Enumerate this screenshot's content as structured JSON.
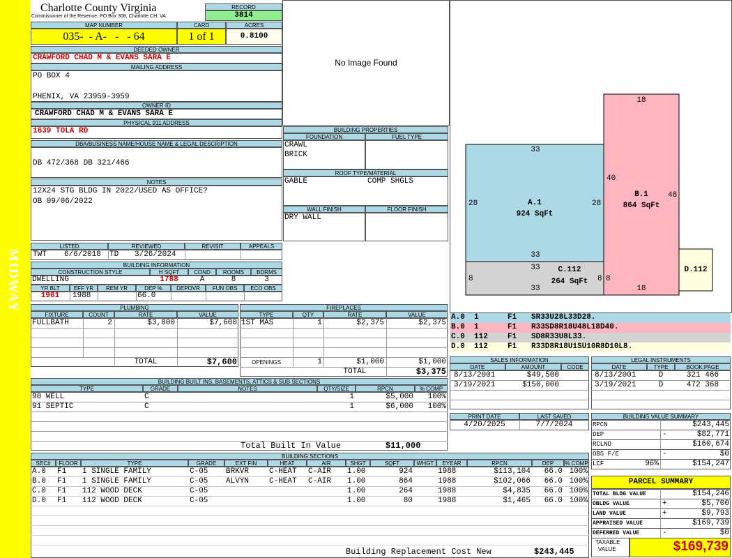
{
  "sidebar": {
    "label": "MIDWAY",
    "color": "#ffff00"
  },
  "header": {
    "county": "Charlotte County Virginia",
    "address": "Commissioner of the Revenue, PO Box 308, Charlotte CH, VA",
    "record_label": "RECORD",
    "record_value": "3814",
    "map_number_label": "MAP NUMBER",
    "map_number": "035-  - A-   -   - 64",
    "card_label": "CARD",
    "card": "1 of 1",
    "acres_label": "ACRES",
    "acres": "0.8100"
  },
  "owner": {
    "deeded_label": "DEEDED OWNER",
    "deeded": "CRAWFORD CHAD M & EVANS SARA E",
    "mailing_label": "MAILING ADDRESS",
    "mailing_line1": "PO BOX 4",
    "mailing_line2": "PHENIX, VA 23959-3959",
    "owner_id_label": "OWNER ID",
    "owner_id": "CRAWFORD CHAD M & EVANS SARA E",
    "physical_label": "PHYSICAL 911 ADDRESS",
    "physical": "1639 TOLA RD",
    "dba_label": "DBA/BUSINESS NAME/HOUSE NAME & LEGAL DESCRIPTION",
    "dba": "DB 472/368 DB 321/466",
    "notes_label": "NOTES",
    "notes_line1": "12X24 STG BLDG IN 2022/USED AS OFFICE?",
    "notes_line2": "OB 09/06/2022"
  },
  "photo": {
    "text": "No Image Found"
  },
  "building_props": {
    "title": "BUILDING PROPERTIES",
    "foundation_label": "FOUNDATION",
    "foundation_1": "CRAWL",
    "foundation_2": "BRICK",
    "fuel_label": "FUEL TYPE",
    "roof_label": "ROOF TYPE/MATERIAL",
    "roof_type": "GABLE",
    "roof_material": "COMP SHGLS",
    "wall_label": "WALL FINISH",
    "wall": "DRY WALL",
    "floor_label": "FLOOR FINISH"
  },
  "review": {
    "listed_label": "LISTED",
    "listed_by": "TWT",
    "listed_date": "6/6/2018",
    "reviewed_label": "REVIEWED",
    "reviewed_by": "TD",
    "reviewed_date": "3/26/2024",
    "revisit_label": "REVISIT",
    "appeals_label": "APPEALS"
  },
  "building_info": {
    "title": "BUILDING INFORMATION",
    "style_label": "CONSTRUCTION STYLE",
    "style": "DWELLING",
    "hsqft_label": "H SQFT",
    "hsqft": "1788",
    "cond_label": "COND",
    "cond": "A",
    "rooms_label": "ROOMS",
    "rooms": "8",
    "bdrms_label": "BDRMS",
    "bdrms": "3",
    "yrblt_label": "YR BLT",
    "yrblt": "1961",
    "effyr_label": "EFF YR",
    "effyr": "1988",
    "remyr_label": "REM YR",
    "remyr": "",
    "dep_label": "DEP %",
    "dep": "66.0",
    "depovr_label": "DEPOVR",
    "funobs_label": "FUN OBS",
    "ecoobs_label": "ECO OBS"
  },
  "plumbing": {
    "title": "PLUMBING",
    "headers": [
      "FIXTURE",
      "COUNT",
      "RATE",
      "VALUE"
    ],
    "rows": [
      {
        "fixture": "FULLBATH",
        "count": "2",
        "rate": "$3,800",
        "value": "$7,600"
      }
    ],
    "total_label": "TOTAL",
    "total": "$7,600"
  },
  "fireplaces": {
    "title": "FIREPLACES",
    "headers": [
      "TYPE",
      "QTY",
      "RATE",
      "VALUE"
    ],
    "rows": [
      {
        "type": "1ST MAS",
        "qty": "1",
        "rate": "$2,375",
        "value": "$2,375"
      }
    ],
    "openings_label": "OPENINGS",
    "openings_qty": "1",
    "openings_rate": "$1,000",
    "openings_value": "$1,000",
    "total_label": "TOTAL",
    "total": "$3,375"
  },
  "builtins": {
    "title": "BUILDING BUILT INS, BASEMENTS, ATTICS & SUB SECTIONS",
    "headers": [
      "TYPE",
      "GRADE",
      "NOTES",
      "QTY/SIZE",
      "RPCN",
      "% COMP"
    ],
    "rows": [
      {
        "type": "90 WELL",
        "grade": "C",
        "notes": "",
        "qty": "1",
        "rpcn": "$5,000",
        "comp": "100%"
      },
      {
        "type": "91 SEPTIC",
        "grade": "C",
        "notes": "",
        "qty": "1",
        "rpcn": "$6,000",
        "comp": "100%"
      }
    ],
    "total_label": "Total Built In Value",
    "total": "$11,000"
  },
  "sections": {
    "title": "BUILDING SECTIONS",
    "headers": [
      "SEC#",
      "FLOOR",
      "TYPE",
      "GRADE",
      "EXT FIN",
      "HEAT",
      "AIR",
      "SHGT",
      "SQFT",
      "WHGT",
      "EYEAR",
      "RPCN",
      "DEP",
      "% COMP"
    ],
    "rows": [
      {
        "sec": "A.0",
        "floor": "F1",
        "type": "1 SINGLE FAMILY",
        "grade": "C-05",
        "ext": "BRKVR",
        "heat": "C-HEAT",
        "air": "C-AIR",
        "shgt": "1.00",
        "sqft": "924",
        "whgt": "",
        "eyear": "1988",
        "rpcn": "$113,104",
        "dep": "66.0",
        "comp": "100%"
      },
      {
        "sec": "B.0",
        "floor": "F1",
        "type": "1 SINGLE FAMILY",
        "grade": "C-05",
        "ext": "ALVYN",
        "heat": "C-HEAT",
        "air": "C-AIR",
        "shgt": "1.00",
        "sqft": "864",
        "whgt": "",
        "eyear": "1988",
        "rpcn": "$102,066",
        "dep": "66.0",
        "comp": "100%"
      },
      {
        "sec": "C.0",
        "floor": "F1",
        "type": "112 WOOD DECK",
        "grade": "C-05",
        "ext": "",
        "heat": "",
        "air": "",
        "shgt": "1.00",
        "sqft": "264",
        "whgt": "",
        "eyear": "1988",
        "rpcn": "$4,835",
        "dep": "66.0",
        "comp": "100%"
      },
      {
        "sec": "D.0",
        "floor": "F1",
        "type": "112 WOOD DECK",
        "grade": "C-05",
        "ext": "",
        "heat": "",
        "air": "",
        "shgt": "1.00",
        "sqft": "80",
        "whgt": "",
        "eyear": "1988",
        "rpcn": "$1,465",
        "dep": "66.0",
        "comp": "100%"
      }
    ],
    "total_label": "Building Replacement Cost New",
    "total": "$243,445"
  },
  "sketch": {
    "A": {
      "label": "A.1",
      "area": "924 SqFt",
      "top": "33",
      "left": "28",
      "right": "28",
      "bottom": "33",
      "color": "#add8e6"
    },
    "B": {
      "label": "B.1",
      "area": "864 SqFt",
      "top": "18",
      "left": "40",
      "right": "48",
      "bottom": "18",
      "color": "#ffb6c1"
    },
    "C": {
      "label": "C.112",
      "area": "264 SqFt",
      "top": "33",
      "left": "8",
      "right": "8",
      "bottom": "33",
      "color": "#d3d3d3"
    },
    "D": {
      "label": "D.112",
      "left": "8",
      "color": "#ffffe0"
    },
    "legend": [
      {
        "code": "A.0",
        "num": "1",
        "floor": "F1",
        "desc": "SR33U28L33D28.",
        "color": "#add8e6"
      },
      {
        "code": "B.0",
        "num": "1",
        "floor": "F1",
        "desc": "R33SD8R18U48L18D40.",
        "color": "#ffb6c1"
      },
      {
        "code": "C.0",
        "num": "112",
        "floor": "F1",
        "desc": "SD8R33U8L33.",
        "color": "#d3d3d3"
      },
      {
        "code": "D.0",
        "num": "112",
        "floor": "F1",
        "desc": "R33D8R18U1SU10R8D10L8.",
        "color": "#ffffe0"
      }
    ]
  },
  "sales": {
    "title": "SALES INFORMATION",
    "headers": [
      "DATE",
      "AMOUNT",
      "CODE"
    ],
    "rows": [
      {
        "date": "8/13/2001",
        "amount": "$49,500",
        "code": ""
      },
      {
        "date": "3/19/2021",
        "amount": "$150,000",
        "code": ""
      }
    ]
  },
  "legal": {
    "title": "LEGAL INSTRUMENTS",
    "headers": [
      "DATE",
      "TYPE",
      "BOOK:PAGE"
    ],
    "rows": [
      {
        "date": "8/13/2001",
        "type": "D",
        "book": "321 466"
      },
      {
        "date": "3/19/2021",
        "type": "D",
        "book": "472 368"
      }
    ]
  },
  "print": {
    "print_label": "PRINT DATE",
    "print_date": "4/20/2025",
    "saved_label": "LAST SAVED",
    "saved_date": "7/7/2024"
  },
  "value_summary": {
    "title": "BUILDING VALUE SUMMARY",
    "rows": [
      {
        "label": "RPCN",
        "pct": "",
        "sign": "",
        "value": "$243,445"
      },
      {
        "label": "DEP",
        "pct": "",
        "sign": "-",
        "value": "$82,771"
      },
      {
        "label": "RCLND",
        "pct": "",
        "sign": "",
        "value": "$160,674"
      },
      {
        "label": "OBS F/E",
        "pct": "",
        "sign": "-",
        "value": "$0"
      },
      {
        "label": "LCF",
        "pct": "96%",
        "sign": "",
        "value": "$154,247"
      }
    ]
  },
  "parcel": {
    "title": "PARCEL SUMMARY",
    "rows": [
      {
        "label": "TOTAL BLDG VALUE",
        "sign": "",
        "value": "$154,246"
      },
      {
        "label": "OBLDG VALUE",
        "sign": "+",
        "value": "$5,700"
      },
      {
        "label": "LAND VALUE",
        "sign": "+",
        "value": "$9,793"
      },
      {
        "label": "APPRAISED VALUE",
        "sign": "",
        "value": "$169,739"
      },
      {
        "label": "DEFERRED VALUE",
        "sign": "-",
        "value": "$0"
      }
    ],
    "taxable_label_1": "TAXABLE",
    "taxable_label_2": "VALUE",
    "taxable": "$169,739"
  }
}
